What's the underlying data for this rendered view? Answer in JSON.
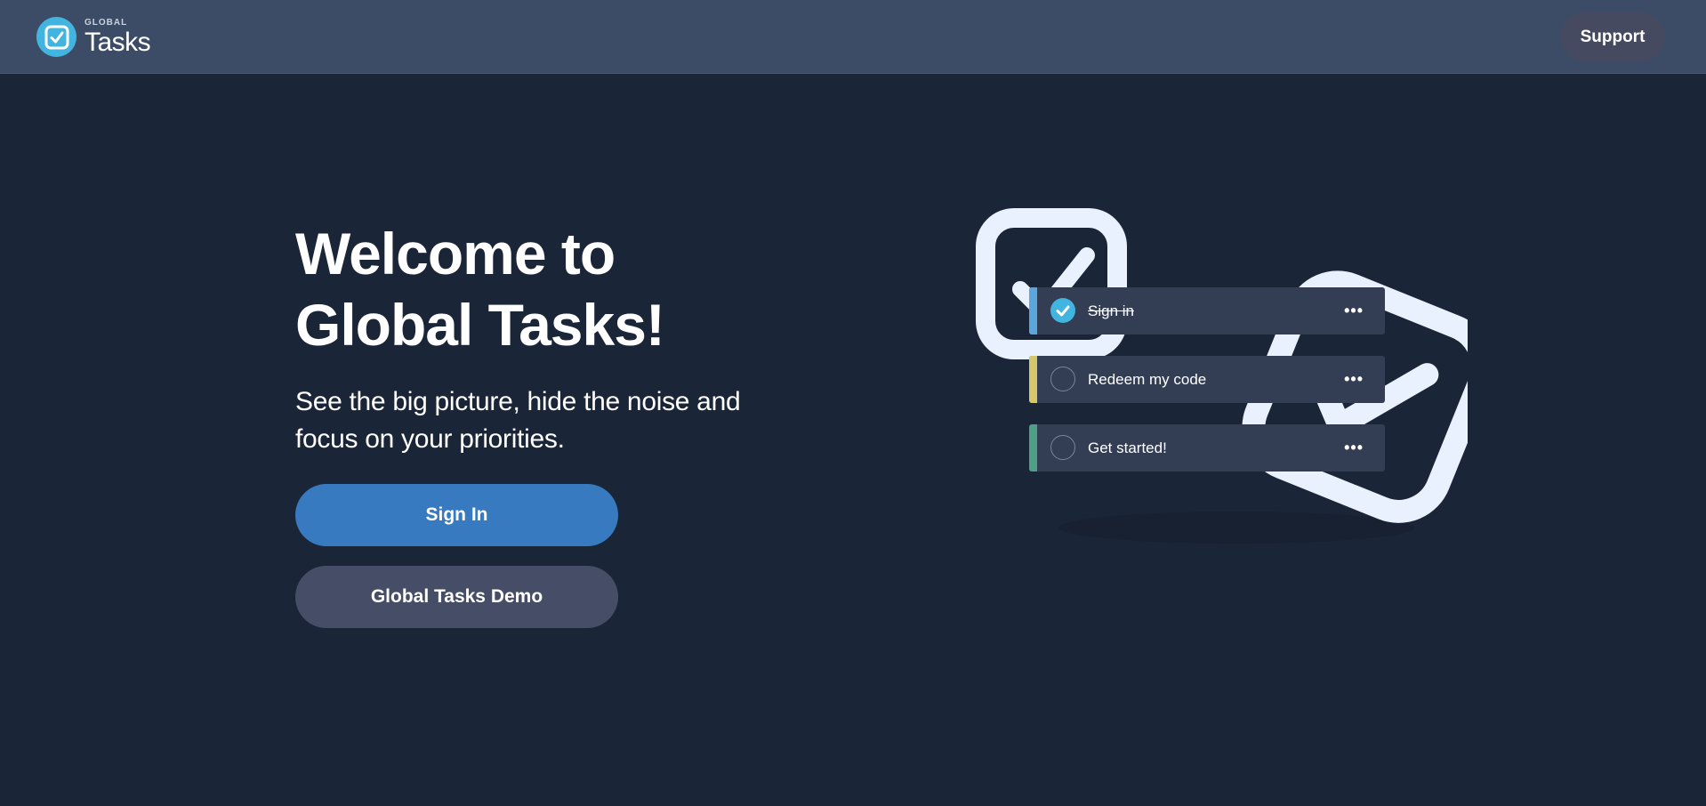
{
  "header": {
    "logo_small": "GLOBAL",
    "logo_big": "Tasks",
    "support_label": "Support"
  },
  "hero": {
    "title_line1": "Welcome to",
    "title_line2": "Global Tasks!",
    "subtitle_line1": "See the big picture, hide the noise and",
    "subtitle_line2": "focus on your priorities.",
    "sign_in_label": "Sign In",
    "demo_label": "Global Tasks Demo"
  },
  "illustration": {
    "tasks": [
      {
        "label": "Sign in",
        "done": true,
        "stripe_color": "#5aa6dd"
      },
      {
        "label": "Redeem my code",
        "done": false,
        "stripe_color": "#d6c76a"
      },
      {
        "label": "Get started!",
        "done": false,
        "stripe_color": "#4f9e86"
      }
    ],
    "menu_glyph": "•••"
  },
  "colors": {
    "background": "#1b2538",
    "topbar": "#3d4c66",
    "accent": "#42b4e0",
    "primary_button": "#377ac0",
    "secondary_button": "#464e67",
    "card": "#333e55"
  }
}
